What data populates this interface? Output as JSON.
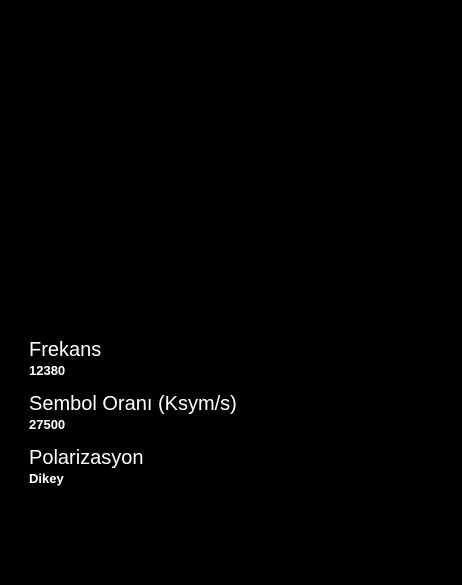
{
  "settings": {
    "items": [
      {
        "label": "Frekans",
        "value": "12380"
      },
      {
        "label": "Sembol Oranı (Ksym/s)",
        "value": "27500"
      },
      {
        "label": "Polarizasyon",
        "value": "Dikey"
      }
    ]
  },
  "colors": {
    "background": "#000000",
    "text": "#ffffff"
  }
}
